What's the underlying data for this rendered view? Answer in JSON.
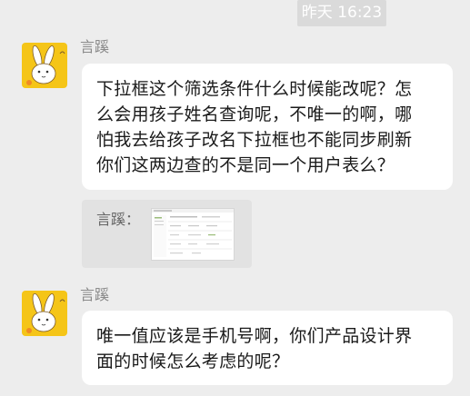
{
  "timestamp": "昨天 16:23",
  "colors": {
    "background": "#ededed",
    "bubble": "#ffffff",
    "avatar_bg": "#f5c518",
    "quote_bg": "#e2e2e2",
    "sender_name": "#8a8a8a"
  },
  "messages": [
    {
      "sender": "言蹊",
      "avatar_icon": "cartoon-rabbit-avatar-icon",
      "lines": [
        "下拉框这个筛选条件什么时候能改呢？怎",
        "么会用孩子姓名查询呢，不唯一的啊，哪",
        "怕我去给孩子改名下拉框也不能同步刷新",
        "你们这两边查的不是同一个用户表么？"
      ]
    },
    {
      "sender": "言蹊",
      "avatar_icon": "cartoon-rabbit-avatar-icon",
      "lines": [
        "唯一值应该是手机号啊，你们产品设计界",
        "面的时候怎么考虑的呢？"
      ]
    }
  ],
  "quote": {
    "label": "言蹊：",
    "thumbnail_icon": "screenshot-thumbnail-icon"
  }
}
